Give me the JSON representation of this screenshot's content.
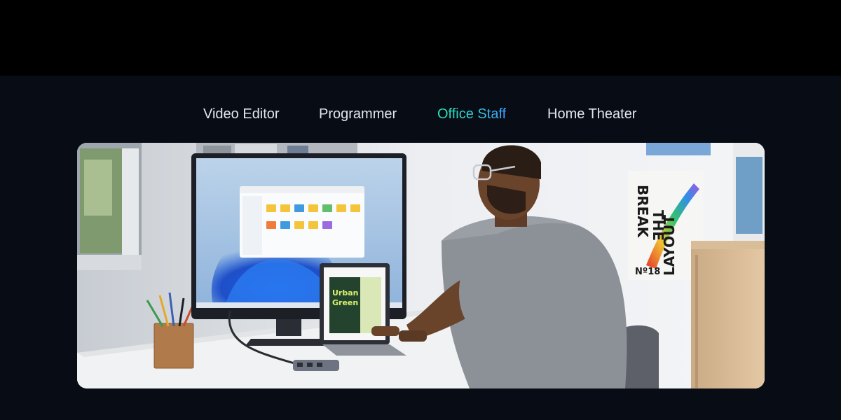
{
  "tabs": [
    {
      "label": "Video Editor",
      "active": false
    },
    {
      "label": "Programmer",
      "active": false
    },
    {
      "label": "Office Staff",
      "active": true
    },
    {
      "label": "Home Theater",
      "active": false
    }
  ],
  "scene": {
    "poster_lines": [
      "BREAK",
      "THE",
      "LAYOUT"
    ],
    "poster_number": "Nº18",
    "laptop_doc_title_1": "Urban",
    "laptop_doc_title_2": "Green"
  },
  "colors": {
    "background": "#080c15",
    "top_band": "#000000",
    "tab_text": "#e3e6ec",
    "tab_active_start": "#29e7b1",
    "tab_active_end": "#3ea1ff"
  }
}
